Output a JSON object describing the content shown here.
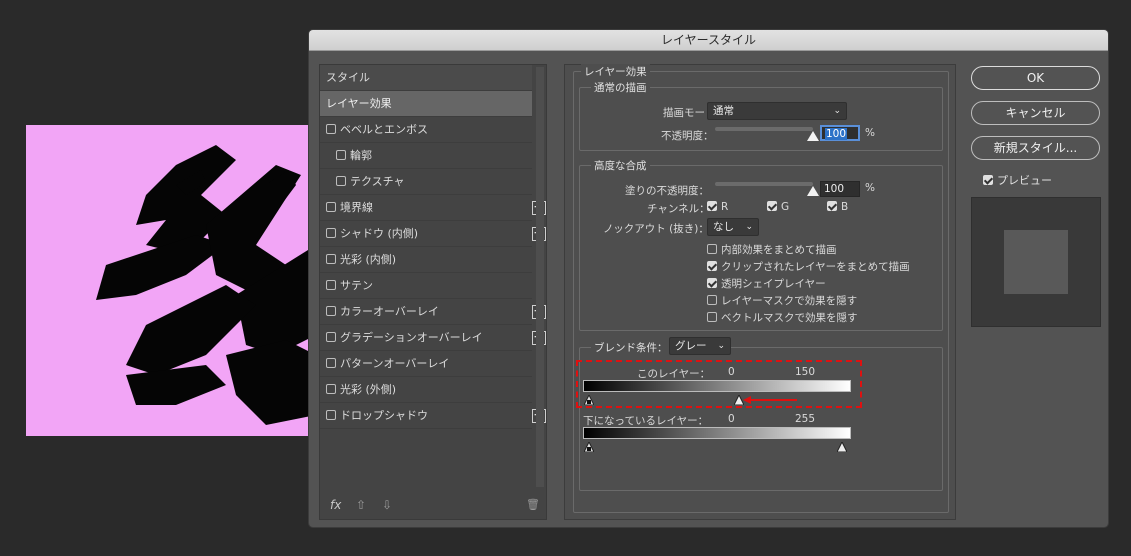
{
  "dialog": {
    "title": "レイヤースタイル"
  },
  "stylelist": {
    "items": [
      {
        "label": "スタイル",
        "checkbox": false,
        "plus": false
      },
      {
        "label": "レイヤー効果",
        "checkbox": false,
        "plus": false,
        "selected": true
      },
      {
        "label": "ベベルとエンボス",
        "checkbox": true,
        "plus": false
      },
      {
        "label": "輪郭",
        "checkbox": true,
        "plus": false,
        "indent": true
      },
      {
        "label": "テクスチャ",
        "checkbox": true,
        "plus": false,
        "indent": true
      },
      {
        "label": "境界線",
        "checkbox": true,
        "plus": true
      },
      {
        "label": "シャドウ (内側)",
        "checkbox": true,
        "plus": true
      },
      {
        "label": "光彩 (内側)",
        "checkbox": true,
        "plus": false
      },
      {
        "label": "サテン",
        "checkbox": true,
        "plus": false
      },
      {
        "label": "カラーオーバーレイ",
        "checkbox": true,
        "plus": true
      },
      {
        "label": "グラデーションオーバーレイ",
        "checkbox": true,
        "plus": true
      },
      {
        "label": "パターンオーバーレイ",
        "checkbox": true,
        "plus": false
      },
      {
        "label": "光彩 (外側)",
        "checkbox": true,
        "plus": false
      },
      {
        "label": "ドロップシャドウ",
        "checkbox": true,
        "plus": true
      }
    ],
    "footer": {
      "fx": "fx",
      "up": "⇧",
      "down": "⇩",
      "trash": "🗑"
    }
  },
  "effects": {
    "group_label": "レイヤー効果",
    "normal": {
      "label": "通常の描画",
      "blend_mode_label": "描画モード：",
      "blend_mode_value": "通常",
      "opacity_label": "不透明度：",
      "opacity_value": "100",
      "opacity_unit": "%",
      "opacity_level": 1.0
    },
    "advanced": {
      "label": "高度な合成",
      "fill_opacity_label": "塗りの不透明度：",
      "fill_opacity_value": "100",
      "fill_opacity_unit": "%",
      "fill_opacity_level": 1.0,
      "channels_label": "チャンネル：",
      "channels": [
        {
          "name": "R",
          "checked": true
        },
        {
          "name": "G",
          "checked": true
        },
        {
          "name": "B",
          "checked": true
        }
      ],
      "knockout_label": "ノックアウト (抜き)：",
      "knockout_value": "なし",
      "options": [
        {
          "label": "内部効果をまとめて描画",
          "checked": false
        },
        {
          "label": "クリップされたレイヤーをまとめて描画",
          "checked": true
        },
        {
          "label": "透明シェイプレイヤー",
          "checked": true
        },
        {
          "label": "レイヤーマスクで効果を隠す",
          "checked": false
        },
        {
          "label": "ベクトルマスクで効果を隠す",
          "checked": false
        }
      ]
    },
    "blendif": {
      "label": "ブレンド条件：",
      "value": "グレー",
      "this_layer_label": "このレイヤー：",
      "this_layer_min": "0",
      "this_layer_max": "150",
      "underlying_label": "下になっているレイヤー：",
      "underlying_min": "0",
      "underlying_max": "255"
    }
  },
  "buttons": {
    "ok": "OK",
    "cancel": "キャンセル",
    "new_style": "新規スタイル...",
    "preview_label": "プレビュー",
    "preview_checked": true
  },
  "colors": {
    "canvas_bg": "#f2a5f6",
    "highlight": "#e01010",
    "accent": "#2d72c8"
  }
}
